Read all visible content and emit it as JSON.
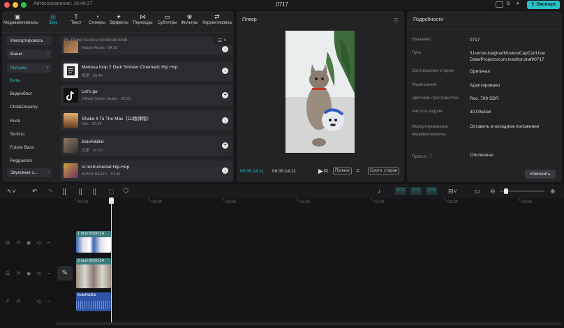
{
  "titlebar": {
    "autosave": "Автосохранение: 16:46:37",
    "title": "0717",
    "export_label": "Экспорт"
  },
  "tabs": [
    {
      "label": "Медиаматериалы",
      "icon": "media-icon",
      "glyph": "▣"
    },
    {
      "label": "Звук",
      "icon": "audio-icon",
      "glyph": "◎"
    },
    {
      "label": "Текст",
      "icon": "text-icon",
      "glyph": "T"
    },
    {
      "label": "Стикеры",
      "icon": "sticker-icon",
      "glyph": "◔"
    },
    {
      "label": "Эффекты",
      "icon": "effects-icon",
      "glyph": "✦"
    },
    {
      "label": "Переходы",
      "icon": "transition-icon",
      "glyph": "⋈"
    },
    {
      "label": "Субтитры",
      "icon": "subtitles-icon",
      "glyph": "▭"
    },
    {
      "label": "Фильтры",
      "icon": "filters-icon",
      "glyph": "❀"
    },
    {
      "label": "Корректировка",
      "icon": "adjust-icon",
      "glyph": "⇄"
    }
  ],
  "sidebar": {
    "import_label": "Импортировать",
    "yours_label": "Ваши",
    "music_label": "Музыка",
    "items": [
      "Биты",
      "Видеоблог",
      "Chill&Dreamy",
      "Rock",
      "Techno",
      "Future Bass",
      "Reggaeton"
    ],
    "sound_effects_label": "Звуковые э..."
  },
  "search": {
    "placeholder": "Поиск песен и исполнителей"
  },
  "tracks": [
    {
      "name": "",
      "meta": "Maurio Rosta · 04:18",
      "action": "download"
    },
    {
      "name": "Medusa loop 2 Dark Sinister Cinematic Hip Hop",
      "meta": "极受 · 00:40",
      "action": "download"
    },
    {
      "name": "Let's go",
      "meta": "Official Sound Studio · 00:20",
      "action": "add"
    },
    {
      "name": "Shake It To The Max（DJ版律版）",
      "meta": "Dirk · 02:38",
      "action": "download"
    },
    {
      "name": "BuleR&Bid",
      "meta": "北里 · 01:00",
      "action": "add"
    },
    {
      "name": "Is Instrumental Hip-Hop",
      "meta": "AVANT-BEATS · 01:40",
      "action": "download"
    }
  ],
  "player": {
    "title": "Плеер",
    "current_time": "00:00:14:11",
    "total_time": "00:00:14:11",
    "full_label": "Полное",
    "ratio_label": "Соотн. сторон"
  },
  "details": {
    "title": "Подробности",
    "rows": [
      {
        "label": "Название:",
        "value": "0717"
      },
      {
        "label": "Путь:",
        "value": "/Users/e.kalgina/Movies/CapCut/User Data/Projects/com.lveditor.draft/0717"
      },
      {
        "label": "Соотношение сторон:",
        "value": "Оригинал"
      },
      {
        "label": "Разрешение:",
        "value": "Адаптировано"
      },
      {
        "label": "Цветовое пространство:",
        "value": "Rec. 709 SDR"
      },
      {
        "label": "Частота кадров:",
        "value": "30.00к/сек"
      },
      {
        "label": "Импортированные медиаматериалы:",
        "value": "Оставить в исходном положении"
      },
      {
        "label": "Прокси: ⓘ",
        "value": "Отключено"
      }
    ],
    "modify_label": "Изменить"
  },
  "timeline": {
    "ruler": [
      "00:00",
      "00:30",
      "01:00",
      "01:30",
      "02:00",
      "02:30",
      "03:00"
    ],
    "clips": [
      {
        "label": "1.mov  00:00:14"
      },
      {
        "label": "2.mov  00:00:14"
      },
      {
        "label": "BuleR&Bid"
      }
    ]
  },
  "colors": {
    "accent": "#2bc1c7",
    "panel": "#232326",
    "background": "#151517"
  }
}
